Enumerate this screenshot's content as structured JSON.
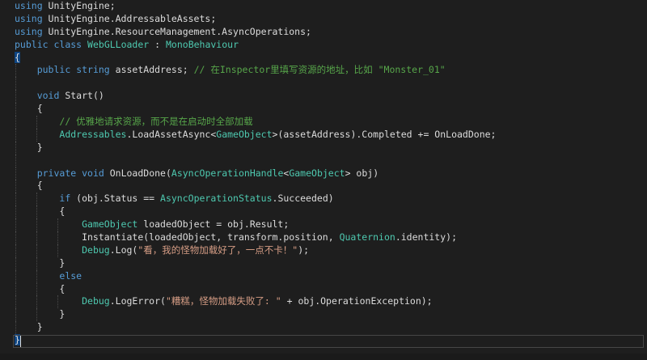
{
  "editor": {
    "theme": {
      "background": "#1e1e1e",
      "keyword": "#569cd6",
      "type": "#4ec9b0",
      "string": "#d69d85",
      "comment": "#57a64a",
      "plain": "#dcdcdc",
      "brace_highlight": "#0e4583"
    },
    "lines": [
      [
        {
          "t": "kw",
          "v": "using"
        },
        {
          "t": "plain",
          "v": " UnityEngine;"
        }
      ],
      [
        {
          "t": "kw",
          "v": "using"
        },
        {
          "t": "plain",
          "v": " UnityEngine.AddressableAssets;"
        }
      ],
      [
        {
          "t": "kw",
          "v": "using"
        },
        {
          "t": "plain",
          "v": " UnityEngine.ResourceManagement.AsyncOperations;"
        }
      ],
      [
        {
          "t": "kw",
          "v": "public"
        },
        {
          "t": "plain",
          "v": " "
        },
        {
          "t": "kw",
          "v": "class"
        },
        {
          "t": "plain",
          "v": " "
        },
        {
          "t": "type",
          "v": "WebGLLoader"
        },
        {
          "t": "plain",
          "v": " : "
        },
        {
          "t": "type",
          "v": "MonoBehaviour"
        }
      ],
      [
        {
          "t": "brace-hl",
          "v": "{"
        }
      ],
      [
        {
          "t": "plain",
          "v": "    "
        },
        {
          "t": "kw",
          "v": "public"
        },
        {
          "t": "plain",
          "v": " "
        },
        {
          "t": "kw",
          "v": "string"
        },
        {
          "t": "plain",
          "v": " assetAddress; "
        },
        {
          "t": "comment",
          "v": "// 在Inspector里填写资源的地址，比如 \"Monster_01\""
        }
      ],
      [],
      [
        {
          "t": "plain",
          "v": "    "
        },
        {
          "t": "kw",
          "v": "void"
        },
        {
          "t": "plain",
          "v": " Start()"
        }
      ],
      [
        {
          "t": "plain",
          "v": "    {"
        }
      ],
      [
        {
          "t": "plain",
          "v": "        "
        },
        {
          "t": "comment",
          "v": "// 优雅地请求资源，而不是在启动时全部加载"
        }
      ],
      [
        {
          "t": "plain",
          "v": "        "
        },
        {
          "t": "type",
          "v": "Addressables"
        },
        {
          "t": "plain",
          "v": ".LoadAssetAsync<"
        },
        {
          "t": "type",
          "v": "GameObject"
        },
        {
          "t": "plain",
          "v": ">(assetAddress).Completed += OnLoadDone;"
        }
      ],
      [
        {
          "t": "plain",
          "v": "    }"
        }
      ],
      [],
      [
        {
          "t": "plain",
          "v": "    "
        },
        {
          "t": "kw",
          "v": "private"
        },
        {
          "t": "plain",
          "v": " "
        },
        {
          "t": "kw",
          "v": "void"
        },
        {
          "t": "plain",
          "v": " OnLoadDone("
        },
        {
          "t": "type",
          "v": "AsyncOperationHandle"
        },
        {
          "t": "plain",
          "v": "<"
        },
        {
          "t": "type",
          "v": "GameObject"
        },
        {
          "t": "plain",
          "v": "> obj)"
        }
      ],
      [
        {
          "t": "plain",
          "v": "    {"
        }
      ],
      [
        {
          "t": "plain",
          "v": "        "
        },
        {
          "t": "kw",
          "v": "if"
        },
        {
          "t": "plain",
          "v": " (obj.Status == "
        },
        {
          "t": "type",
          "v": "AsyncOperationStatus"
        },
        {
          "t": "plain",
          "v": ".Succeeded)"
        }
      ],
      [
        {
          "t": "plain",
          "v": "        {"
        }
      ],
      [
        {
          "t": "plain",
          "v": "            "
        },
        {
          "t": "type",
          "v": "GameObject"
        },
        {
          "t": "plain",
          "v": " loadedObject = obj.Result;"
        }
      ],
      [
        {
          "t": "plain",
          "v": "            Instantiate(loadedObject, transform.position, "
        },
        {
          "t": "type",
          "v": "Quaternion"
        },
        {
          "t": "plain",
          "v": ".identity);"
        }
      ],
      [
        {
          "t": "plain",
          "v": "            "
        },
        {
          "t": "type",
          "v": "Debug"
        },
        {
          "t": "plain",
          "v": ".Log("
        },
        {
          "t": "str",
          "v": "\"看，我的怪物加载好了，一点不卡！\""
        },
        {
          "t": "plain",
          "v": ");"
        }
      ],
      [
        {
          "t": "plain",
          "v": "        }"
        }
      ],
      [
        {
          "t": "plain",
          "v": "        "
        },
        {
          "t": "kw",
          "v": "else"
        }
      ],
      [
        {
          "t": "plain",
          "v": "        {"
        }
      ],
      [
        {
          "t": "plain",
          "v": "            "
        },
        {
          "t": "type",
          "v": "Debug"
        },
        {
          "t": "plain",
          "v": ".LogError("
        },
        {
          "t": "str",
          "v": "\"糟糕，怪物加载失败了: \""
        },
        {
          "t": "plain",
          "v": " + obj.OperationException);"
        }
      ],
      [
        {
          "t": "plain",
          "v": "        }"
        }
      ],
      [
        {
          "t": "plain",
          "v": "    }"
        }
      ],
      [
        {
          "t": "brace-hl",
          "v": "}"
        }
      ]
    ]
  }
}
